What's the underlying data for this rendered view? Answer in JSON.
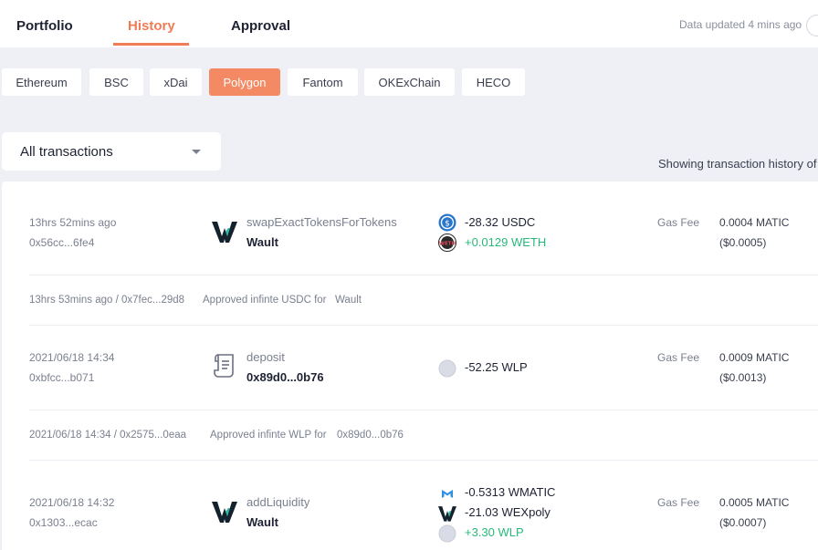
{
  "nav": {
    "tabs": [
      "Portfolio",
      "History",
      "Approval"
    ],
    "active": "History",
    "updated": "Data updated 4 mins ago"
  },
  "chains": {
    "items": [
      "Ethereum",
      "BSC",
      "xDai",
      "Polygon",
      "Fantom",
      "OKExChain",
      "HECO"
    ],
    "active": "Polygon"
  },
  "filter": {
    "selected": "All transactions",
    "showing": "Showing transaction history of"
  },
  "transactions": [
    {
      "time": "13hrs 52mins ago",
      "hash": "0x56cc...6fe4",
      "method": "swapExactTokensForTokens",
      "project": "Wault",
      "project_icon": "wault-logo-icon",
      "tokens": [
        {
          "icon": "usdc-icon",
          "amount": "-28.32 USDC",
          "positive": false
        },
        {
          "icon": "weth-icon",
          "amount": "+0.0129 WETH",
          "positive": true
        }
      ],
      "gas_label": "Gas Fee",
      "gas_value": "0.0004 MATIC",
      "gas_usd": "($0.0005)"
    },
    {
      "approval": true,
      "time_hash": "13hrs 53mins ago / 0x7fec...29d8",
      "text": "Approved infinte USDC for",
      "target": "Wault"
    },
    {
      "time": "2021/06/18 14:34",
      "hash": "0xbfcc...b071",
      "method": "deposit",
      "project": "0x89d0...0b76",
      "project_icon": "contract-scroll-icon",
      "tokens": [
        {
          "icon": "wlp-icon",
          "amount": "-52.25 WLP",
          "positive": false
        }
      ],
      "gas_label": "Gas Fee",
      "gas_value": "0.0009 MATIC",
      "gas_usd": "($0.0013)"
    },
    {
      "approval": true,
      "time_hash": "2021/06/18 14:34 / 0x2575...0eaa",
      "text": "Approved infinte WLP for",
      "target": "0x89d0...0b76"
    },
    {
      "time": "2021/06/18 14:32",
      "hash": "0x1303...ecac",
      "method": "addLiquidity",
      "project": "Wault",
      "project_icon": "wault-logo-icon",
      "tokens": [
        {
          "icon": "wmatic-icon",
          "amount": "-0.5313 WMATIC",
          "positive": false
        },
        {
          "icon": "wex-icon",
          "amount": "-21.03 WEXpoly",
          "positive": false
        },
        {
          "icon": "wlp-icon",
          "amount": "+3.30 WLP",
          "positive": true
        }
      ],
      "gas_label": "Gas Fee",
      "gas_value": "0.0005 MATIC",
      "gas_usd": "($0.0007)"
    }
  ],
  "colors": {
    "accent": "#f07c55",
    "chip_active": "#f38a63",
    "positive": "#28b87a",
    "background": "#eef0f6"
  }
}
